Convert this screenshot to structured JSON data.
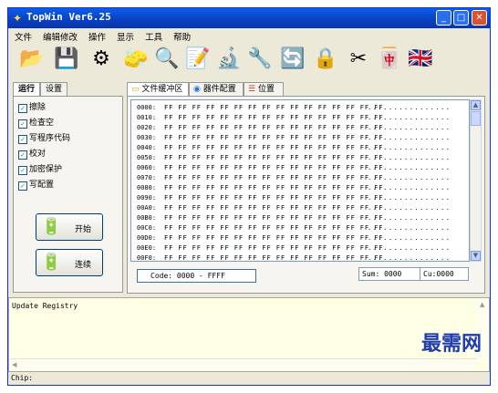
{
  "window": {
    "title": "TopWin Ver6.25"
  },
  "menu": [
    "文件",
    "编辑修改",
    "操作",
    "显示",
    "工具",
    "帮助"
  ],
  "toolbar": [
    {
      "icon": "folder-open-icon",
      "glyph": "📂"
    },
    {
      "icon": "save-icon",
      "glyph": "💾"
    },
    {
      "icon": "chip-icon",
      "glyph": "⚙"
    },
    {
      "icon": "eraser-icon",
      "glyph": "🧽"
    },
    {
      "icon": "search-chip-icon",
      "glyph": "🔍"
    },
    {
      "icon": "write-icon",
      "glyph": "📝"
    },
    {
      "icon": "verify-icon",
      "glyph": "🔬"
    },
    {
      "icon": "config-icon",
      "glyph": "🔧"
    },
    {
      "icon": "auto-icon",
      "glyph": "🔄"
    },
    {
      "icon": "lock-icon",
      "glyph": "🔒"
    },
    {
      "icon": "tools-icon",
      "glyph": "✂"
    },
    {
      "icon": "language-icon",
      "glyph": "🀄"
    },
    {
      "icon": "english-flag-icon",
      "glyph": "🇬🇧"
    }
  ],
  "left_tabs": [
    "运行",
    "设置"
  ],
  "options": [
    "擦除",
    "检查空",
    "写程序代码",
    "校对",
    "加密保护",
    "写配置"
  ],
  "buttons": {
    "start": "开始",
    "continue": "连续"
  },
  "right_tabs": [
    "文件缓冲区",
    "器件配置",
    "位置"
  ],
  "hex": {
    "addresses": [
      "0000:",
      "0010:",
      "0020:",
      "0030:",
      "0040:",
      "0050:",
      "0060:",
      "0070:",
      "0080:",
      "0090:",
      "00A0:",
      "00B0:",
      "00C0:",
      "00D0:",
      "00E0:",
      "00F0:"
    ],
    "bytes": "FF FF FF FF FF FF FF FF FF FF FF FF FF FF FF FF",
    "ascii": "................"
  },
  "code_range": "Code: 0000 - FFFF",
  "sum": "Sum:  0000",
  "cu": "Cu:0000",
  "log": "Update Registry",
  "watermark": "最需网",
  "status": "Chip:"
}
